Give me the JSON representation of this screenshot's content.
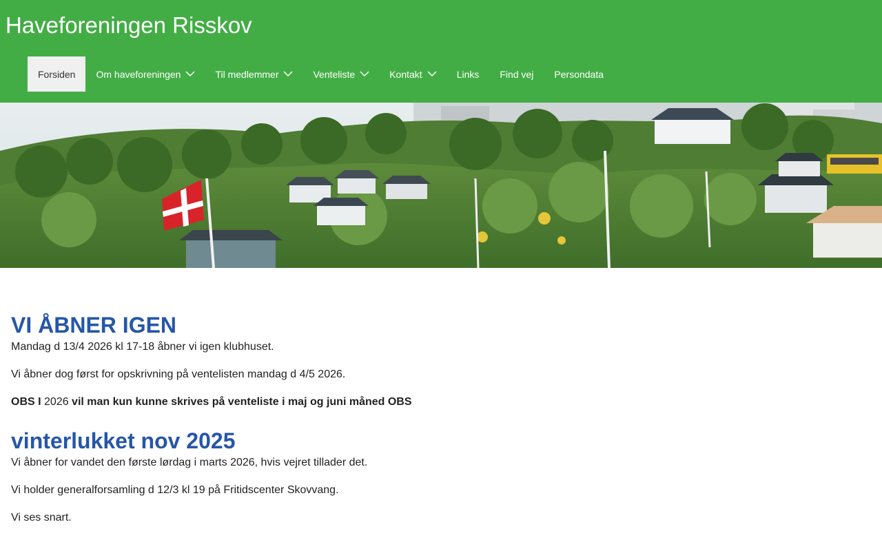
{
  "site": {
    "title": "Haveforeningen Risskov"
  },
  "colors": {
    "header_bg": "#43ad45",
    "heading": "#2656a8",
    "active_tab_bg": "#f0f0f0"
  },
  "nav": {
    "items": [
      {
        "label": "Forsiden",
        "active": true,
        "has_submenu": false
      },
      {
        "label": "Om haveforeningen",
        "active": false,
        "has_submenu": true
      },
      {
        "label": "Til medlemmer",
        "active": false,
        "has_submenu": true
      },
      {
        "label": "Venteliste",
        "active": false,
        "has_submenu": true
      },
      {
        "label": "Kontakt",
        "active": false,
        "has_submenu": true
      },
      {
        "label": "Links",
        "active": false,
        "has_submenu": false
      },
      {
        "label": "Find vej",
        "active": false,
        "has_submenu": false
      },
      {
        "label": "Persondata",
        "active": false,
        "has_submenu": false
      }
    ],
    "submenu_icon": "chevron-down-icon"
  },
  "sections": [
    {
      "heading": "VI ÅBNER IGEN",
      "p1": "Mandag d 13/4 2026 kl 17-18 åbner vi igen klubhuset.",
      "p2": "Vi åbner dog først for opskrivning på ventelisten mandag d 4/5 2026.",
      "p3_bold_a": "OBS I",
      "p3_normal": " 2026 ",
      "p3_bold_b": "vil man kun kunne skrives på venteliste i maj og juni måned OBS"
    },
    {
      "heading": "vinterlukket nov 2025",
      "p1": "Vi åbner for vandet den første lørdag i marts 2026, hvis vejret tillader det.",
      "p2": "Vi holder generalforsamling d 12/3 kl 19 på Fritidscenter Skovvang.",
      "p3": "Vi ses snart."
    }
  ]
}
